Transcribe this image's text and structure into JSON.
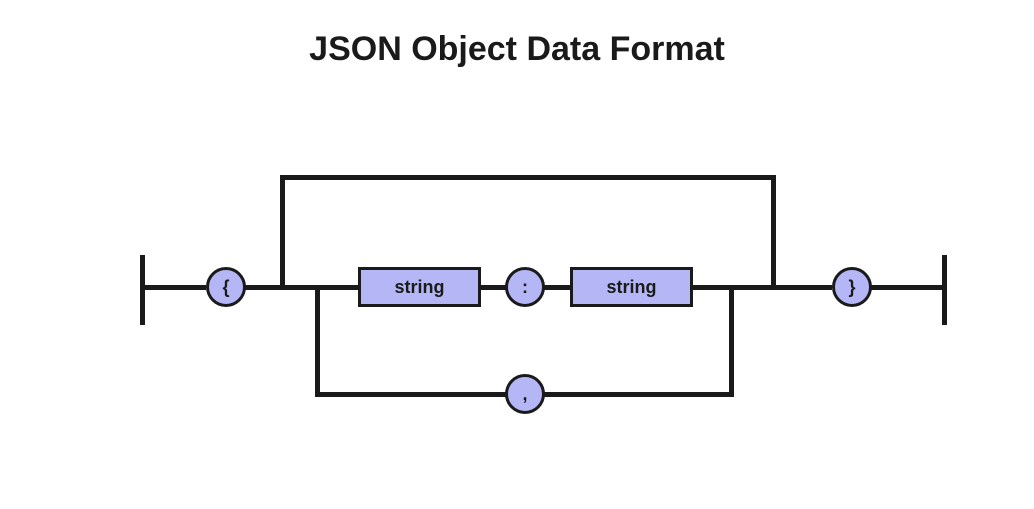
{
  "title": "JSON Object Data Format",
  "tokens": {
    "open_brace": "{",
    "close_brace": "}",
    "colon": ":",
    "comma": ",",
    "string1": "string",
    "string2": "string"
  },
  "colors": {
    "fill": "#b5b6f5",
    "stroke": "#1a1a1a"
  }
}
